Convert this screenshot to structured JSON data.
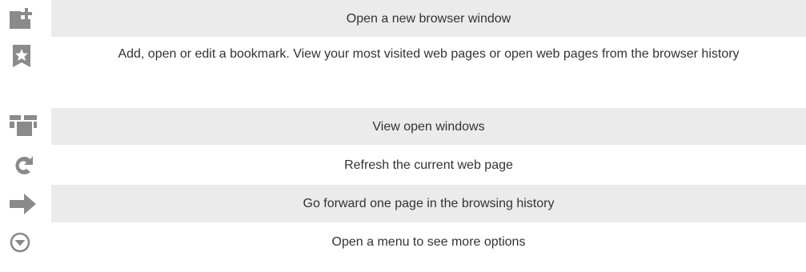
{
  "rows": [
    {
      "icon": "new-window-icon",
      "text": "Open a new browser window",
      "shaded": true
    },
    {
      "icon": "bookmark-star-icon",
      "text": "Add, open or edit a bookmark. View your most visited web pages or open web pages from the browser history",
      "shaded": false
    },
    {
      "icon": "windows-icon",
      "text": "View open windows",
      "shaded": true
    },
    {
      "icon": "refresh-icon",
      "text": "Refresh the current web page",
      "shaded": false
    },
    {
      "icon": "forward-arrow-icon",
      "text": "Go forward one page in the browsing history",
      "shaded": true
    },
    {
      "icon": "menu-icon",
      "text": "Open a menu to see more options",
      "shaded": false
    }
  ],
  "colors": {
    "icon": "#8a8a8a",
    "row_shade": "#ebebeb",
    "text": "#333333"
  }
}
